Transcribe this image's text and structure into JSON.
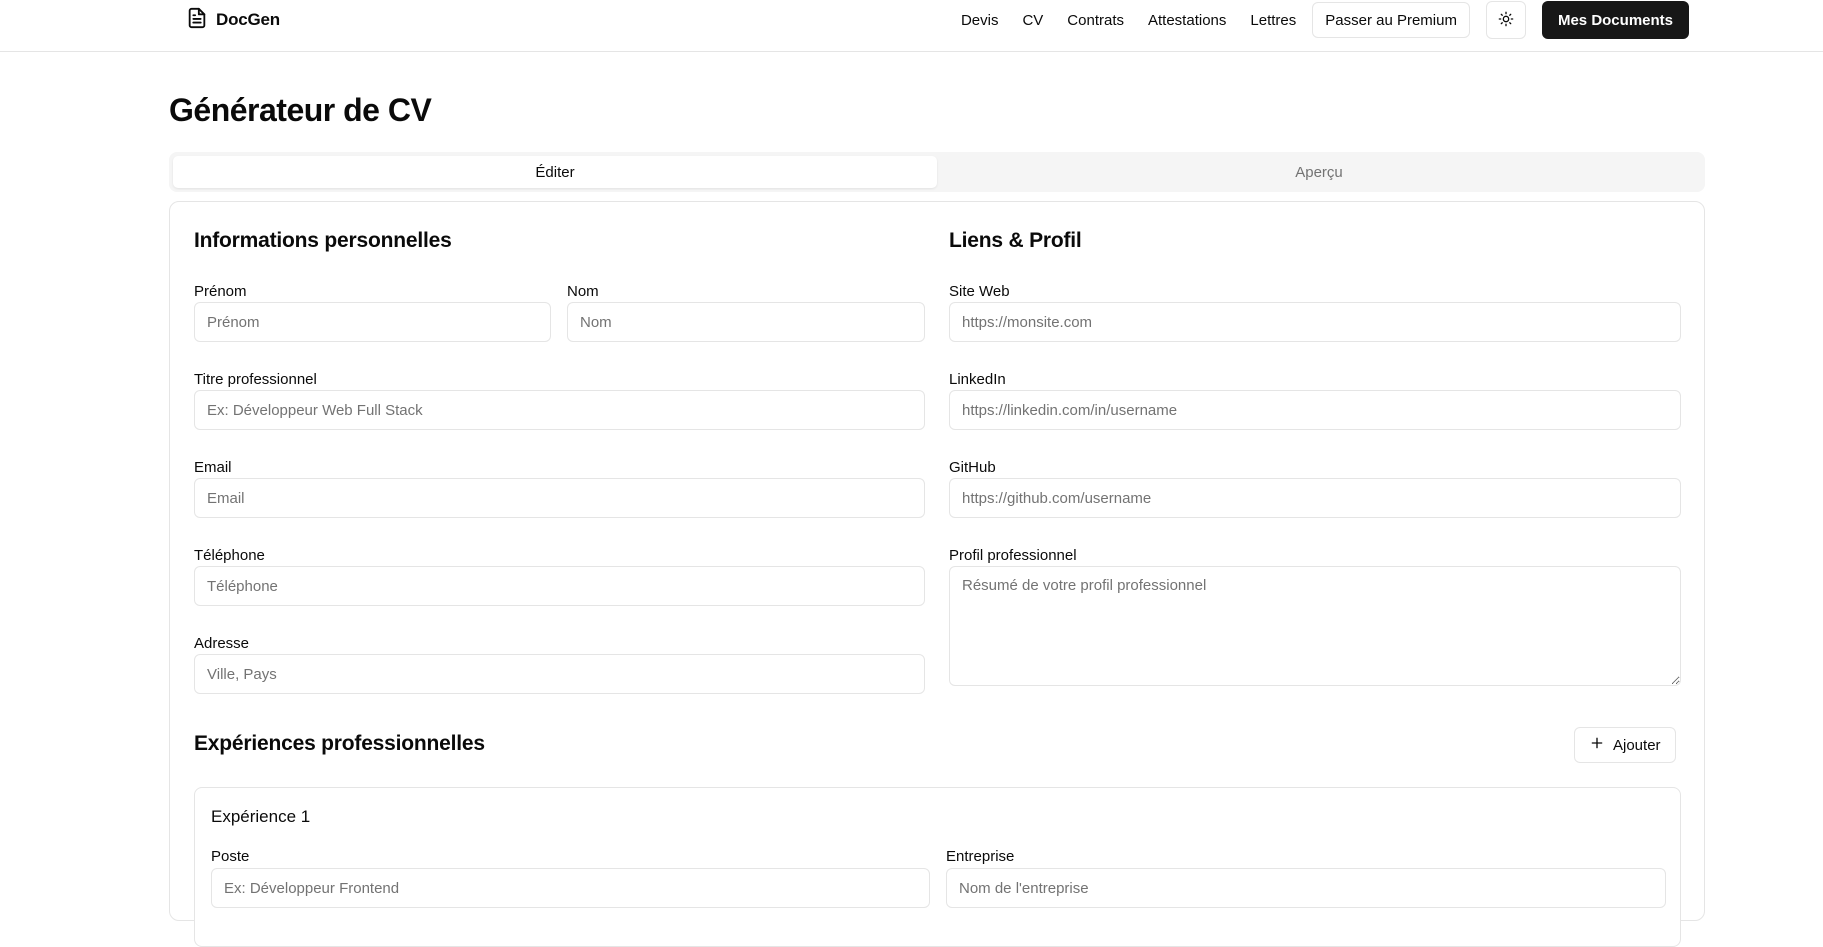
{
  "brand": {
    "name": "DocGen",
    "icon": "file-text-icon"
  },
  "nav": {
    "links": [
      "Devis",
      "CV",
      "Contrats",
      "Attestations",
      "Lettres"
    ],
    "premium_label": "Passer au Premium",
    "theme_icon": "sun-icon",
    "documents_label": "Mes Documents"
  },
  "page": {
    "title": "Générateur de CV"
  },
  "tabs": {
    "edit": "Éditer",
    "preview": "Aperçu",
    "active": "edit"
  },
  "personal": {
    "title": "Informations personnelles",
    "first_name": {
      "label": "Prénom",
      "placeholder": "Prénom",
      "value": ""
    },
    "last_name": {
      "label": "Nom",
      "placeholder": "Nom",
      "value": ""
    },
    "job_title": {
      "label": "Titre professionnel",
      "placeholder": "Ex: Développeur Web Full Stack",
      "value": ""
    },
    "email": {
      "label": "Email",
      "placeholder": "Email",
      "value": ""
    },
    "phone": {
      "label": "Téléphone",
      "placeholder": "Téléphone",
      "value": ""
    },
    "address": {
      "label": "Adresse",
      "placeholder": "Ville, Pays",
      "value": ""
    }
  },
  "links": {
    "title": "Liens & Profil",
    "website": {
      "label": "Site Web",
      "placeholder": "https://monsite.com",
      "value": ""
    },
    "linkedin": {
      "label": "LinkedIn",
      "placeholder": "https://linkedin.com/in/username",
      "value": ""
    },
    "github": {
      "label": "GitHub",
      "placeholder": "https://github.com/username",
      "value": ""
    },
    "profile": {
      "label": "Profil professionnel",
      "placeholder": "Résumé de votre profil professionnel",
      "value": ""
    }
  },
  "experience": {
    "title": "Expériences professionnelles",
    "add_label": "Ajouter",
    "add_icon": "plus-icon",
    "items": [
      {
        "title": "Expérience 1",
        "position": {
          "label": "Poste",
          "placeholder": "Ex: Développeur Frontend",
          "value": ""
        },
        "company": {
          "label": "Entreprise",
          "placeholder": "Nom de l'entreprise",
          "value": ""
        }
      }
    ]
  },
  "colors": {
    "primary": "#171717",
    "border": "#e5e5e5",
    "muted": "#737373",
    "tab_bg": "#f5f5f5"
  }
}
